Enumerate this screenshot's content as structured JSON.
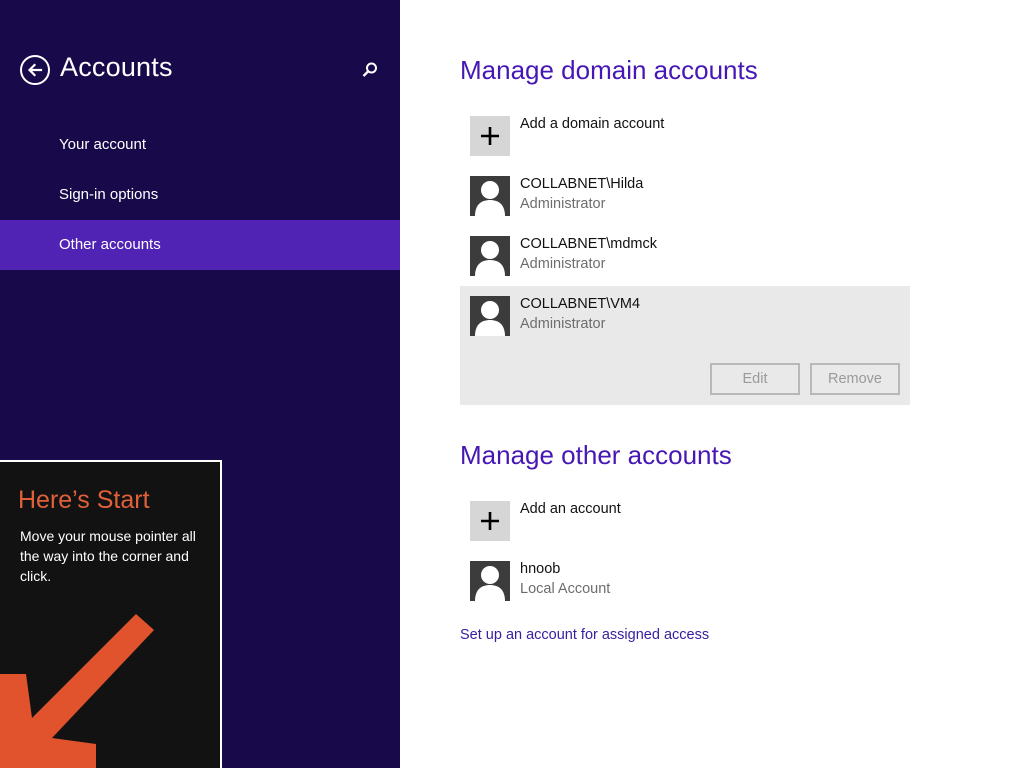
{
  "left_pane": {
    "title": "Accounts",
    "nav_items": [
      {
        "label": "Your account"
      },
      {
        "label": "Sign-in options"
      },
      {
        "label": "Other accounts"
      }
    ],
    "active_index": 2
  },
  "start_tip": {
    "title": "Here’s Start",
    "body": "Move your mouse pointer all the way into the corner and click."
  },
  "domain_section": {
    "heading": "Manage domain accounts",
    "add_label": "Add a domain account",
    "accounts": [
      {
        "name": "COLLABNET\\Hilda",
        "role": "Administrator"
      },
      {
        "name": "COLLABNET\\mdmck",
        "role": "Administrator"
      },
      {
        "name": "COLLABNET\\VM4",
        "role": "Administrator"
      }
    ],
    "selected_index": 2,
    "edit_label": "Edit",
    "remove_label": "Remove"
  },
  "other_section": {
    "heading": "Manage other accounts",
    "add_label": "Add an account",
    "accounts": [
      {
        "name": "hnoob",
        "role": "Local Account"
      }
    ],
    "assigned_access_link": "Set up an account for assigned access"
  },
  "colors": {
    "left_pane_bg": "#180a4a",
    "nav_active_bg": "#5123b4",
    "heading": "#4617b4",
    "tip_title": "#e0603a",
    "tip_arrow": "#e0532c"
  },
  "icons": [
    "back-arrow-icon",
    "search-icon",
    "plus-icon",
    "user-avatar-icon",
    "start-corner-arrow-icon"
  ]
}
